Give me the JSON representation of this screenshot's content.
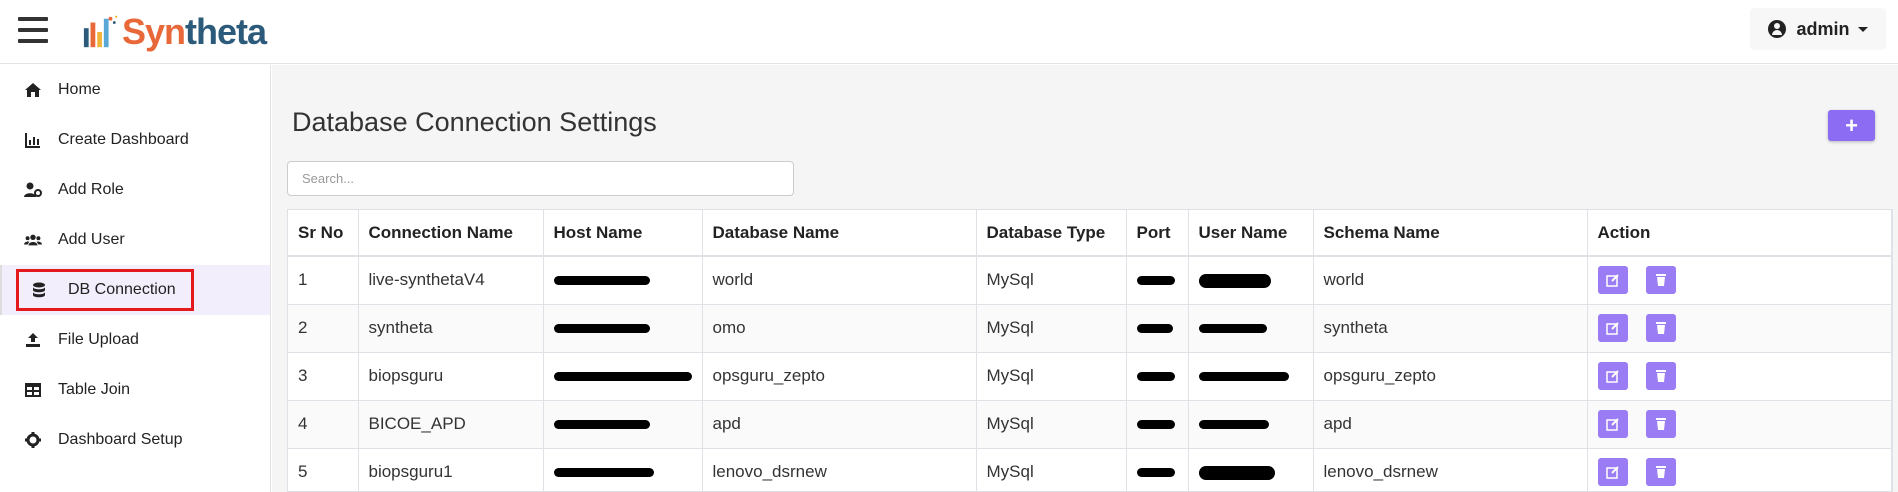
{
  "brand": {
    "syn": "Syn",
    "theta": "theta",
    "colors": {
      "orange": "#e8683a",
      "blue": "#2c5a7a"
    }
  },
  "header": {
    "user": "admin",
    "user_icon": "user-circle-icon"
  },
  "sidebar": {
    "items": [
      {
        "label": "Home",
        "icon": "home-icon"
      },
      {
        "label": "Create Dashboard",
        "icon": "chart-icon"
      },
      {
        "label": "Add Role",
        "icon": "user-cog-icon"
      },
      {
        "label": "Add User",
        "icon": "users-icon"
      },
      {
        "label": "DB Connection",
        "icon": "database-icon",
        "active": true
      },
      {
        "label": "File Upload",
        "icon": "upload-icon"
      },
      {
        "label": "Table Join",
        "icon": "table-icon"
      },
      {
        "label": "Dashboard Setup",
        "icon": "gear-icon"
      }
    ]
  },
  "main": {
    "title": "Database Connection Settings",
    "add_button_icon": "plus-icon",
    "search": {
      "placeholder": "Search...",
      "value": ""
    },
    "table": {
      "headers": [
        "Sr No",
        "Connection Name",
        "Host Name",
        "Database Name",
        "Database Type",
        "Port",
        "User Name",
        "Schema Name",
        "Action"
      ],
      "rows": [
        {
          "sr": "1",
          "connection": "live-synthetaV4",
          "database": "world",
          "type": "MySql",
          "schema": "world"
        },
        {
          "sr": "2",
          "connection": "syntheta",
          "database": "omo",
          "type": "MySql",
          "schema": "syntheta"
        },
        {
          "sr": "3",
          "connection": "biopsguru",
          "database": "opsguru_zepto",
          "type": "MySql",
          "schema": "opsguru_zepto"
        },
        {
          "sr": "4",
          "connection": "BICOE_APD",
          "database": "apd",
          "type": "MySql",
          "schema": "apd"
        },
        {
          "sr": "5",
          "connection": "biopsguru1",
          "database": "lenovo_dsrnew",
          "type": "MySql",
          "schema": "lenovo_dsrnew"
        }
      ]
    },
    "accent_color": "#8b6cf3"
  }
}
